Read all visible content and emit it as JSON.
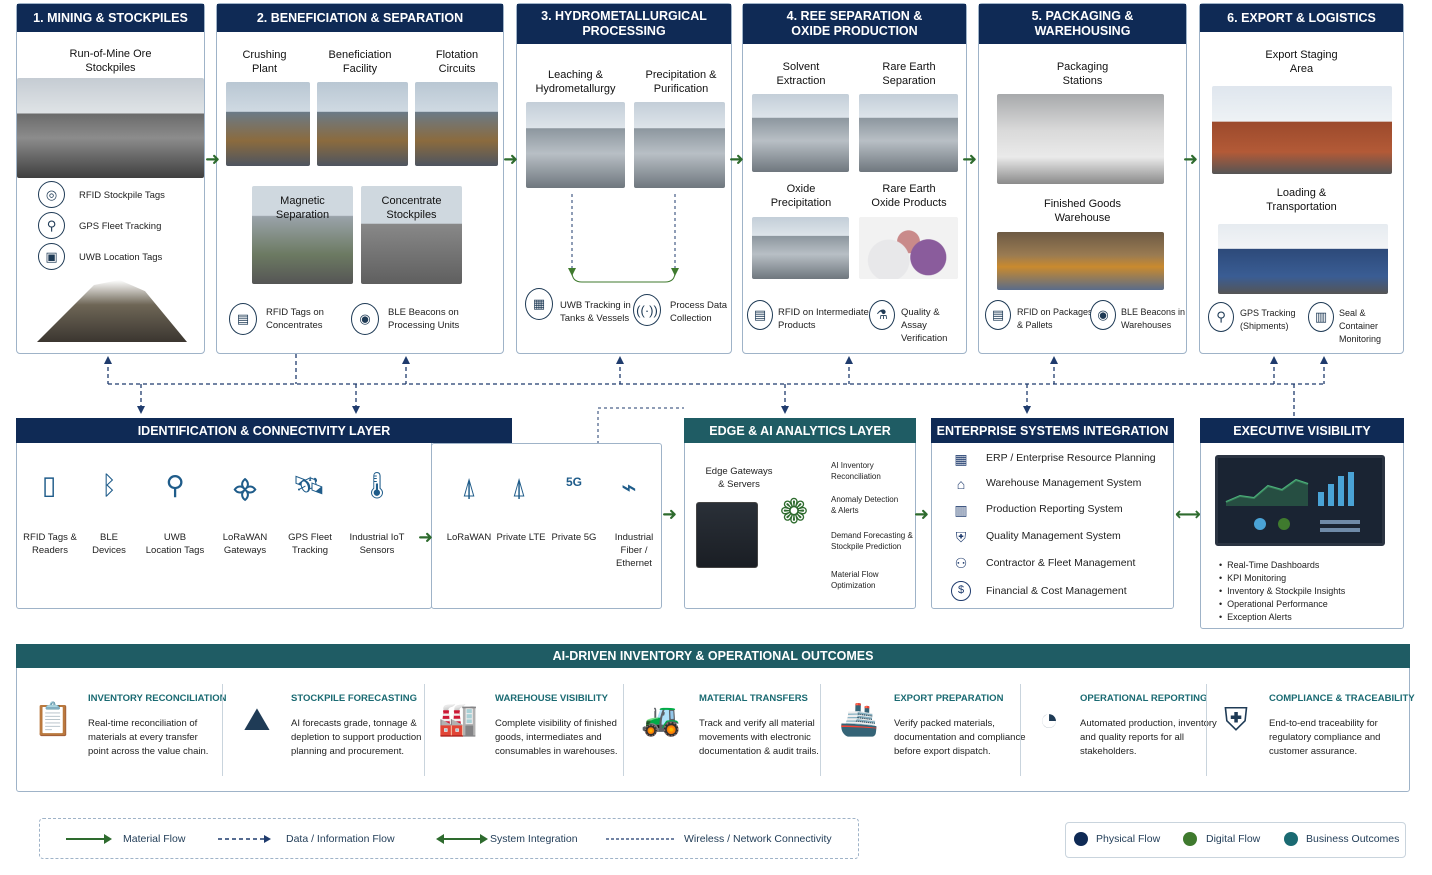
{
  "stages": [
    {
      "title": "1. MINING & STOCKPILES",
      "sub": [
        "Run-of-Mine Ore",
        "Stockpiles"
      ],
      "tags": [
        "RFID Stockpile Tags",
        "GPS Fleet Tracking",
        "UWB Location Tags"
      ]
    },
    {
      "title": "2. BENEFICIATION & SEPARATION",
      "top": [
        "Crushing\nPlant",
        "Beneficiation\nFacility",
        "Flotation\nCircuits"
      ],
      "mid": [
        "Magnetic\nSeparation",
        "Concentrate\nStockpiles"
      ],
      "tags": [
        "RFID Tags on\nConcentrates",
        "BLE Beacons on\nProcessing Units"
      ]
    },
    {
      "title": "3. HYDROMETALLURGICAL\nPROCESSING",
      "top": [
        "Leaching &\nHydrometallurgy",
        "Precipitation &\nPurification"
      ],
      "tags": [
        "UWB Tracking in\nTanks & Vessels",
        "Process Data\nCollection"
      ]
    },
    {
      "title": "4. REE SEPARATION &\nOXIDE PRODUCTION",
      "top": [
        "Solvent\nExtraction",
        "Rare Earth\nSeparation"
      ],
      "mid": [
        "Oxide\nPrecipitation",
        "Rare Earth\nOxide Products"
      ],
      "tags": [
        "RFID on Intermediate\nProducts",
        "Quality & Assay\nVerification"
      ]
    },
    {
      "title": "5. PACKAGING &\nWAREHOUSING",
      "top": [
        "Packaging\nStations",
        "Finished Goods\nWarehouse"
      ],
      "tags": [
        "RFID on Packages\n& Pallets",
        "BLE Beacons in\nWarehouses"
      ]
    },
    {
      "title": "6. EXPORT & LOGISTICS",
      "top": [
        "Export Staging\nArea",
        "Loading &\nTransportation"
      ],
      "tags": [
        "GPS Tracking\n(Shipments)",
        "Seal & Container\nMonitoring"
      ]
    }
  ],
  "identification": {
    "title": "IDENTIFICATION & CONNECTIVITY LAYER",
    "devices": [
      "RFID Tags &\nReaders",
      "BLE\nDevices",
      "UWB\nLocation Tags",
      "LoRaWAN\nGateways",
      "GPS Fleet\nTracking",
      "Industrial IoT\nSensors"
    ],
    "networks": [
      "LoRaWAN",
      "Private LTE",
      "Private 5G",
      "Industrial\nFiber / Ethernet"
    ],
    "icons": {
      "5g": "5G"
    }
  },
  "edge": {
    "title": "EDGE & AI ANALYTICS LAYER",
    "gateway": "Edge Gateways\n& Servers",
    "items": [
      "AI Inventory\nReconciliation",
      "Anomaly Detection\n& Alerts",
      "Demand Forecasting &\nStockpile Prediction",
      "Material Flow\nOptimization"
    ]
  },
  "enterprise": {
    "title": "ENTERPRISE SYSTEMS INTEGRATION",
    "items": [
      "ERP / Enterprise Resource Planning",
      "Warehouse Management System",
      "Production Reporting System",
      "Quality Management System",
      "Contractor & Fleet Management",
      "Financial & Cost Management"
    ],
    "icons": {
      "dollar": "$"
    }
  },
  "executive": {
    "title": "EXECUTIVE VISIBILITY",
    "items": [
      "Real-Time Dashboards",
      "KPI Monitoring",
      "Inventory & Stockpile Insights",
      "Operational Performance",
      "Exception Alerts"
    ]
  },
  "outcomes": {
    "title": "AI-DRIVEN INVENTORY & OPERATIONAL OUTCOMES",
    "items": [
      {
        "title": "INVENTORY RECONCILIATION",
        "text": "Real-time reconciliation of\nmaterials at every transfer\npoint across the value chain."
      },
      {
        "title": "STOCKPILE FORECASTING",
        "text": "AI forecasts grade, tonnage &\ndepletion to support production\nplanning and procurement."
      },
      {
        "title": "WAREHOUSE VISIBILITY",
        "text": "Complete visibility of finished\ngoods, intermediates and\nconsumables in warehouses."
      },
      {
        "title": "MATERIAL TRANSFERS",
        "text": "Track and verify all material\nmovements with electronic\ndocumentation & audit trails."
      },
      {
        "title": "EXPORT PREPARATION",
        "text": "Verify packed materials,\ndocumentation and compliance\nbefore export dispatch."
      },
      {
        "title": "OPERATIONAL REPORTING",
        "text": "Automated production, inventory\nand quality reports for all\nstakeholders."
      },
      {
        "title": "COMPLIANCE & TRACEABILITY",
        "text": "End-to-end traceability for\nregulatory compliance and\ncustomer assurance."
      }
    ]
  },
  "legend": {
    "lines": [
      "Material Flow",
      "Data / Information Flow",
      "System Integration",
      "Wireless / Network Connectivity"
    ],
    "dots": [
      {
        "label": "Physical Flow",
        "color": "#0f2a55"
      },
      {
        "label": "Digital Flow",
        "color": "#3f7a2e"
      },
      {
        "label": "Business Outcomes",
        "color": "#1a6a72"
      }
    ]
  },
  "colors": {
    "navy": "#0f2a55",
    "green": "#2e6b2e",
    "teal": "#1f5c64"
  }
}
